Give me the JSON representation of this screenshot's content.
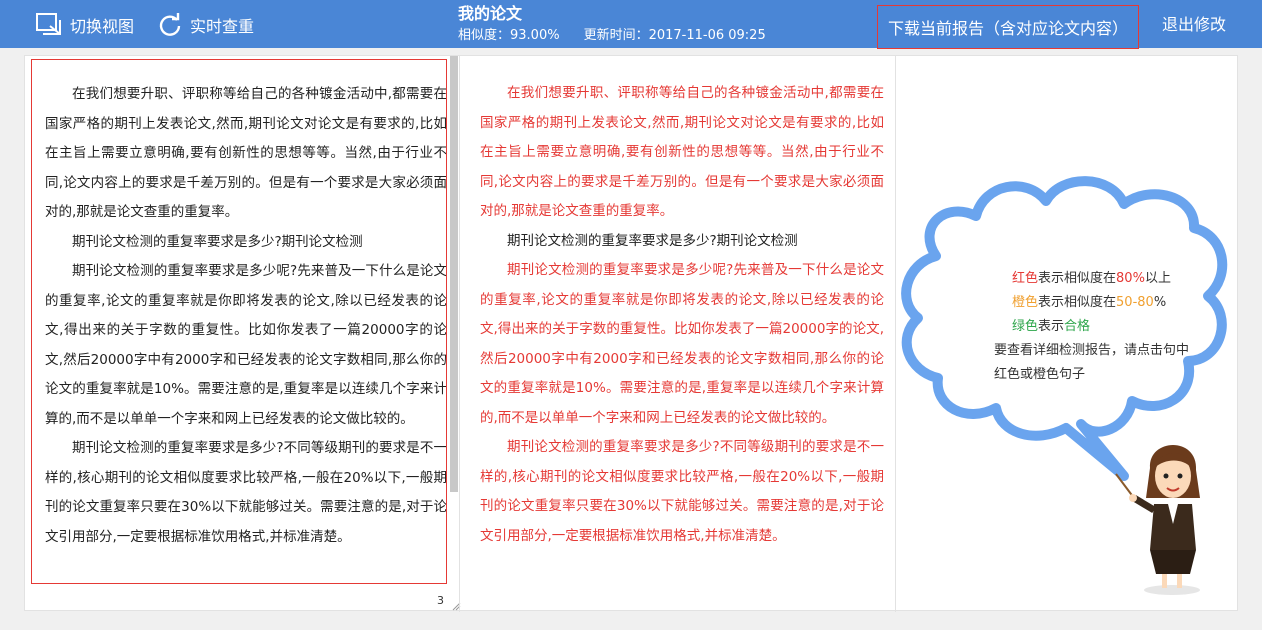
{
  "toolbar": {
    "switch_view_label": "切换视图",
    "realtime_check_label": "实时查重",
    "download_label": "下载当前报告（含对应论文内容）",
    "exit_label": "退出修改"
  },
  "header": {
    "title": "我的论文",
    "similarity": "相似度：93.00%",
    "updated": "更新时间：2017-11-06 09:25"
  },
  "editor": {
    "paragraphs": [
      "在我们想要升职、评职称等给自己的各种镀金活动中,都需要在国家严格的期刊上发表论文,然而,期刊论文对论文是有要求的,比如在主旨上需要立意明确,要有创新性的思想等等。当然,由于行业不同,论文内容上的要求是千差万别的。但是有一个要求是大家必须面对的,那就是论文查重的重复率。",
      "期刊论文检测的重复率要求是多少?期刊论文检测",
      "期刊论文检测的重复率要求是多少呢?先来普及一下什么是论文的重复率,论文的重复率就是你即将发表的论文,除以已经发表的论文,得出来的关于字数的重复性。比如你发表了一篇20000字的论文,然后20000字中有2000字和已经发表的论文字数相同,那么你的论文的重复率就是10%。需要注意的是,重复率是以连续几个字来计算的,而不是以单单一个字来和网上已经发表的论文做比较的。",
      "期刊论文检测的重复率要求是多少?不同等级期刊的要求是不一样的,核心期刊的论文相似度要求比较严格,一般在20%以下,一般期刊的论文重复率只要在30%以下就能够过关。需要注意的是,对于论文引用部分,一定要根据标准饮用格式,并标准清楚。"
    ],
    "page_number": "3"
  },
  "report": {
    "paragraphs": [
      {
        "text": "在我们想要升职、评职称等给自己的各种镀金活动中,都需要在国家严格的期刊上发表论文,然而,期刊论文对论文是有要求的,比如在主旨上需要立意明确,要有创新性的思想等等。当然,由于行业不同,论文内容上的要求是千差万别的。但是有一个要求是大家必须面对的,那就是论文查重的重复率。",
        "color": "red"
      },
      {
        "text": "期刊论文检测的重复率要求是多少?期刊论文检测",
        "color": "black"
      },
      {
        "text": "期刊论文检测的重复率要求是多少呢?先来普及一下什么是论文的重复率,论文的重复率就是你即将发表的论文,除以已经发表的论文,得出来的关于字数的重复性。比如你发表了一篇20000字的论文,然后20000字中有2000字和已经发表的论文字数相同,那么你的论文的重复率就是10%。需要注意的是,重复率是以连续几个字来计算的,而不是以单单一个字来和网上已经发表的论文做比较的。",
        "color": "red"
      },
      {
        "text": "期刊论文检测的重复率要求是多少?不同等级期刊的要求是不一样的,核心期刊的论文相似度要求比较严格,一般在20%以下,一般期刊的论文重复率只要在30%以下就能够过关。需要注意的是,对于论文引用部分,一定要根据标准饮用格式,并标准清楚。",
        "color": "red"
      }
    ]
  },
  "legend": {
    "red_word": "红色",
    "red_mid": "表示相似度在",
    "red_value": "80%",
    "red_tail": "以上",
    "orange_word": "橙色",
    "orange_mid": "表示相似度在",
    "orange_value": "50-80",
    "orange_tail": "%",
    "green_word": "绿色",
    "green_mid": "表示",
    "green_value": "合格",
    "hint": "要查看详细检测报告，请点击句中红色或橙色句子"
  },
  "colors": {
    "header_bg": "#4a86d6",
    "red": "#e53935",
    "orange": "#f0a030",
    "green": "#2ea64b",
    "cloud": "#6aa4ee"
  }
}
